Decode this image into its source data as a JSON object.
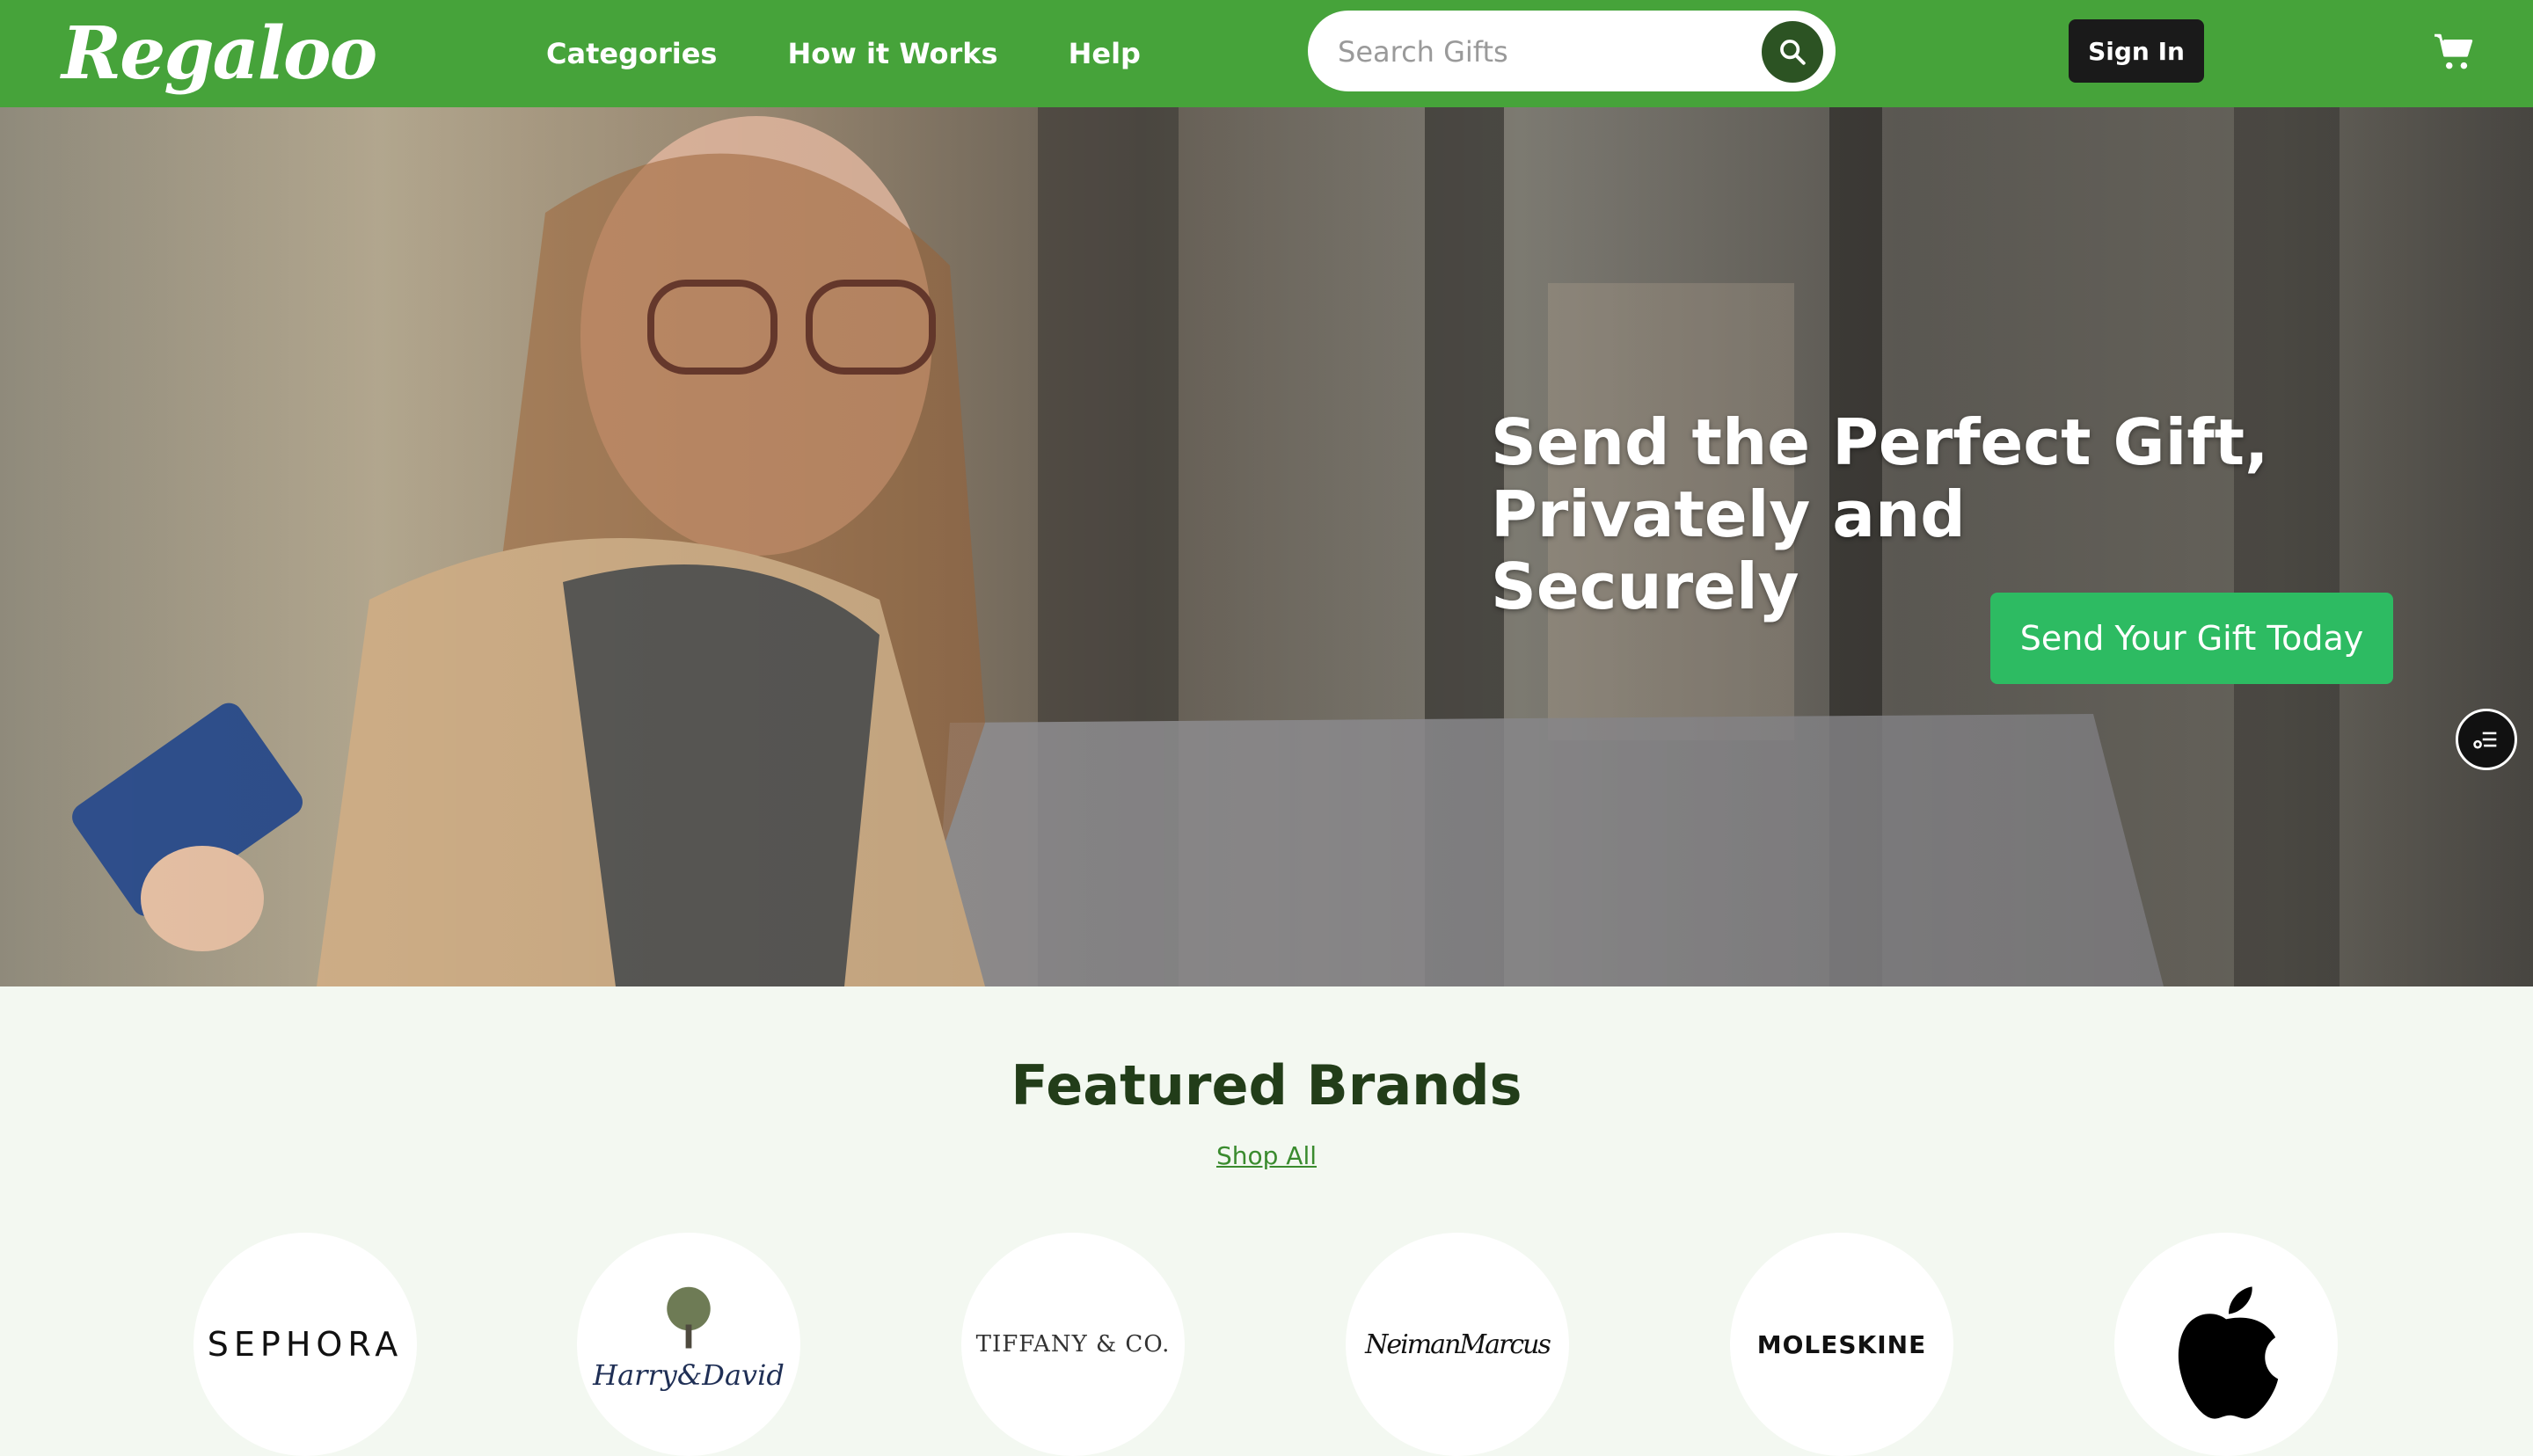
{
  "header": {
    "logo": "Regaloo",
    "nav": [
      "Categories",
      "How it Works",
      "Help"
    ],
    "search_placeholder": "Search Gifts",
    "signin_label": "Sign In"
  },
  "hero": {
    "title_line1": "Send the Perfect Gift,",
    "title_line2": "Privately and Securely",
    "cta_label": "Send Your Gift Today"
  },
  "featured": {
    "title": "Featured Brands",
    "shop_all": "Shop All",
    "brands": [
      "SEPHORA",
      "Harry&David",
      "TIFFANY & CO.",
      "NeimanMarcus",
      "MOLESKINE",
      "Apple"
    ]
  },
  "icons": {
    "search": "search-icon",
    "cart": "cart-icon",
    "floating": "list-icon"
  },
  "colors": {
    "header_green": "#46a33a",
    "cta_green": "#2dbb62",
    "title_green": "#223d19"
  }
}
